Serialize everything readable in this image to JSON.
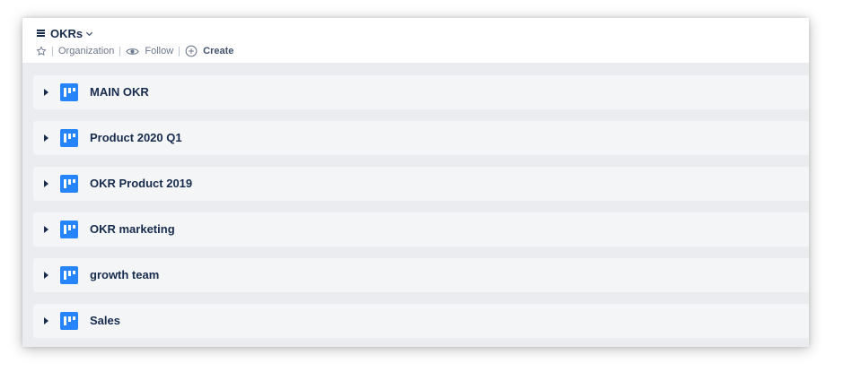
{
  "header": {
    "title": "OKRs",
    "meta": {
      "organization_label": "Organization",
      "follow_label": "Follow",
      "create_label": "Create"
    }
  },
  "boards": [
    {
      "label": "MAIN OKR",
      "icon": "board-icon"
    },
    {
      "label": "Product 2020 Q1",
      "icon": "board-icon"
    },
    {
      "label": "OKR Product 2019",
      "icon": "board-icon"
    },
    {
      "label": "OKR marketing",
      "icon": "board-icon"
    },
    {
      "label": "growth team",
      "icon": "board-icon"
    },
    {
      "label": "Sales",
      "icon": "board-icon"
    }
  ],
  "colors": {
    "accent": "#2684ff",
    "text": "#172b4d",
    "muted": "#6b778c",
    "background": "#ebecf0",
    "row": "#f4f5f7"
  }
}
